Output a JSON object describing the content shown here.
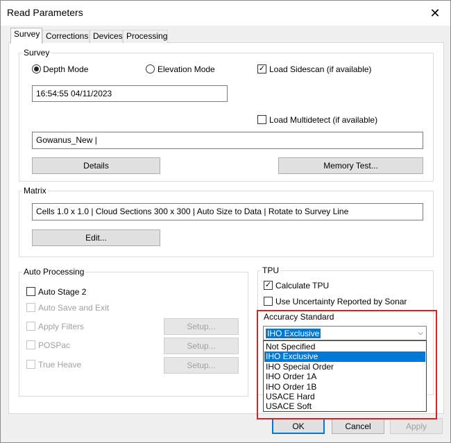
{
  "window": {
    "title": "Read Parameters"
  },
  "tabs": [
    "Survey",
    "Corrections",
    "Devices",
    "Processing"
  ],
  "survey": {
    "group_label": "Survey",
    "depth_mode_label": "Depth Mode",
    "elevation_mode_label": "Elevation Mode",
    "selected_mode": "Depth Mode",
    "load_sidescan_label": "Load Sidescan (if available)",
    "load_sidescan_checked": true,
    "datetime_value": "16:54:55 04/11/2023",
    "load_multidetect_label": "Load Multidetect (if available)",
    "load_multidetect_checked": false,
    "survey_name_value": "Gowanus_New |",
    "details_button": "Details",
    "memory_test_button": "Memory Test..."
  },
  "matrix": {
    "group_label": "Matrix",
    "summary_value": "Cells 1.0 x 1.0 | Cloud Sections 300 x 300 | Auto Size to Data | Rotate to Survey Line",
    "edit_button": "Edit..."
  },
  "auto_processing": {
    "group_label": "Auto Processing",
    "auto_stage_2_label": "Auto Stage 2",
    "auto_save_label": "Auto Save and Exit",
    "apply_filters_label": "Apply Filters",
    "pospac_label": "POSPac",
    "true_heave_label": "True Heave",
    "setup_button": "Setup..."
  },
  "tpu": {
    "group_label": "TPU",
    "calculate_tpu_label": "Calculate TPU",
    "calculate_tpu_checked": true,
    "use_uncertainty_label": "Use Uncertainty Reported by Sonar",
    "use_uncertainty_checked": false,
    "accuracy_label": "Accuracy Standard",
    "selected_value": "IHO Exclusive",
    "options": [
      "Not Specified",
      "IHO Exclusive",
      "IHO Special Order",
      "IHO Order 1A",
      "IHO Order 1B",
      "USACE Hard",
      "USACE Soft"
    ]
  },
  "footer": {
    "ok_button": "OK",
    "cancel_button": "Cancel",
    "apply_button": "Apply"
  },
  "colors": {
    "highlight": "#e02020",
    "selection": "#0078d7"
  }
}
